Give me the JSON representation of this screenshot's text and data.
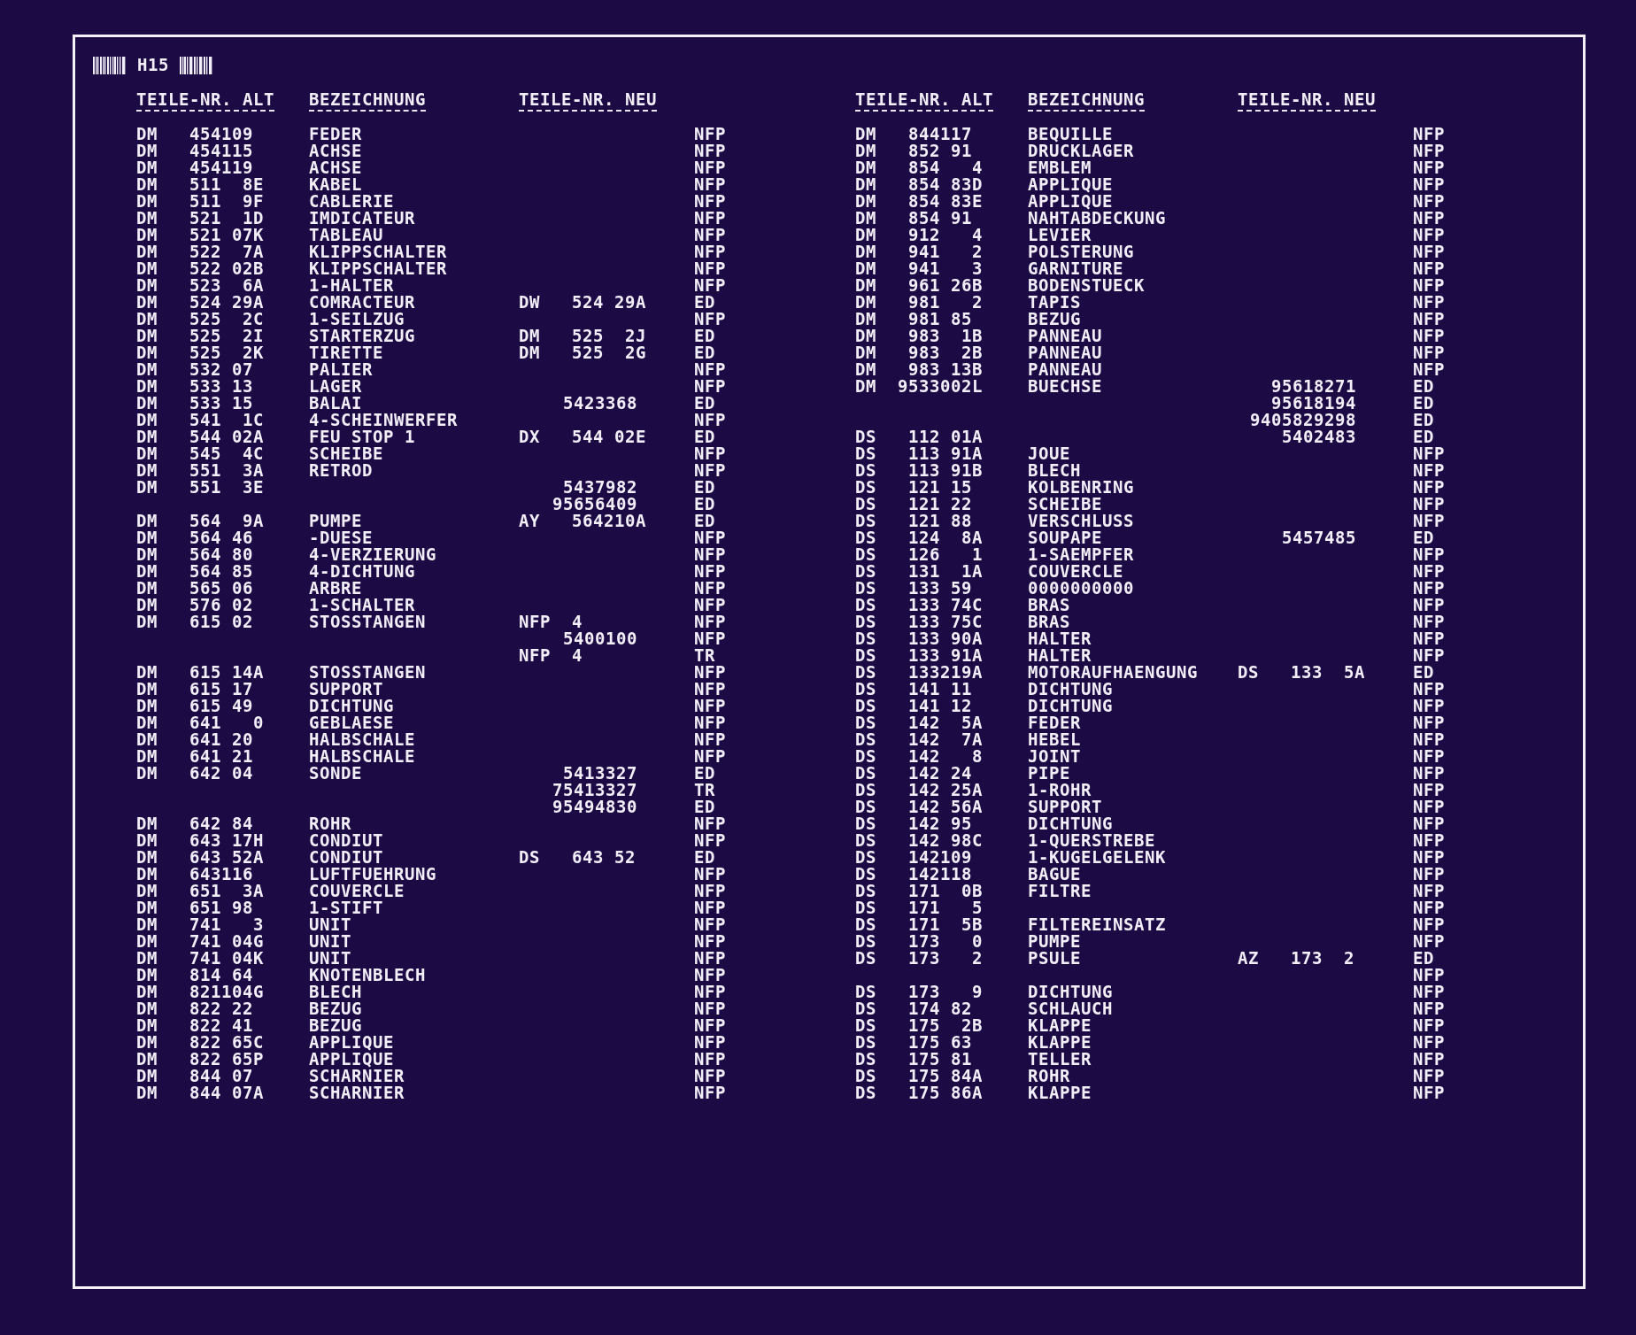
{
  "header": {
    "label": "H15"
  },
  "tables": [
    {
      "columns": [
        "TEILE-NR. ALT",
        "BEZEICHNUNG",
        "TEILE-NR. NEU"
      ],
      "rows": [
        {
          "old": "DM   454109",
          "desc": "FEDER",
          "code": "NFP"
        },
        {
          "old": "DM   454115",
          "desc": "ACHSE",
          "code": "NFP"
        },
        {
          "old": "DM   454119",
          "desc": "ACHSE",
          "code": "NFP"
        },
        {
          "old": "DM   511  8E",
          "desc": "KABEL",
          "code": "NFP"
        },
        {
          "old": "DM   511  9F",
          "desc": "CABLERIE",
          "code": "NFP"
        },
        {
          "old": "DM   521  1D",
          "desc": "IMDICATEUR",
          "code": "NFP"
        },
        {
          "old": "DM   521 07K",
          "desc": "TABLEAU",
          "code": "NFP"
        },
        {
          "old": "DM   522  7A",
          "desc": "KLIPPSCHALTER",
          "code": "NFP"
        },
        {
          "old": "DM   522 02B",
          "desc": "KLIPPSCHALTER",
          "code": "NFP"
        },
        {
          "old": "DM   523  6A",
          "desc": "1-HALTER",
          "code": "NFP"
        },
        {
          "old": "DM   524 29A",
          "desc": "COMRACTEUR",
          "new_ref": "DW   524 29A",
          "code": "ED"
        },
        {
          "old": "DM   525  2C",
          "desc": "1-SEILZUG",
          "code": "NFP"
        },
        {
          "old": "DM   525  2I",
          "desc": "STARTERZUG",
          "new_ref": "DM   525  2J",
          "code": "ED"
        },
        {
          "old": "DM   525  2K",
          "desc": "TIRETTE",
          "new_ref": "DM   525  2G",
          "code": "ED"
        },
        {
          "old": "DM   532 07",
          "desc": "PALIER",
          "code": "NFP"
        },
        {
          "old": "DM   533 13",
          "desc": "LAGER",
          "code": "NFP"
        },
        {
          "old": "DM   533 15",
          "desc": "BALAI",
          "new_no": "5423368",
          "code": "ED"
        },
        {
          "old": "DM   541  1C",
          "desc": "4-SCHEINWERFER",
          "code": "NFP"
        },
        {
          "old": "DM   544 02A",
          "desc": "FEU STOP 1",
          "new_ref": "DX   544 02E",
          "code": "ED"
        },
        {
          "old": "DM   545  4C",
          "desc": "SCHEIBE",
          "code": "NFP"
        },
        {
          "old": "DM   551  3A",
          "desc": "RETROD",
          "code": "NFP"
        },
        {
          "old": "DM   551  3E",
          "new_no": "5437982",
          "code": "ED"
        },
        {
          "new_no": "95656409",
          "code": "ED"
        },
        {
          "old": "DM   564  9A",
          "desc": "PUMPE",
          "new_ref": "AY   564210A",
          "code": "ED"
        },
        {
          "old": "DM   564 46",
          "desc": "-DUESE",
          "code": "NFP"
        },
        {
          "old": "DM   564 80",
          "desc": "4-VERZIERUNG",
          "code": "NFP"
        },
        {
          "old": "DM   564 85",
          "desc": "4-DICHTUNG",
          "code": "NFP"
        },
        {
          "old": "DM   565 06",
          "desc": "ARBRE",
          "code": "NFP"
        },
        {
          "old": "DM   576 02",
          "desc": "1-SCHALTER",
          "code": "NFP"
        },
        {
          "old": "DM   615 02",
          "desc": "STOSSTANGEN",
          "new_ref": "NFP  4",
          "code": "NFP"
        },
        {
          "new_no": "5400100",
          "code": "NFP"
        },
        {
          "new_ref": "NFP  4",
          "code": "TR"
        },
        {
          "old": "DM   615 14A",
          "desc": "STOSSTANGEN",
          "code": "NFP"
        },
        {
          "old": "DM   615 17",
          "desc": "SUPPORT",
          "code": "NFP"
        },
        {
          "old": "DM   615 49",
          "desc": "DICHTUNG",
          "code": "NFP"
        },
        {
          "old": "DM   641   0",
          "desc": "GEBLAESE",
          "code": "NFP"
        },
        {
          "old": "DM   641 20",
          "desc": "HALBSCHALE",
          "code": "NFP"
        },
        {
          "old": "DM   641 21",
          "desc": "HALBSCHALE",
          "code": "NFP"
        },
        {
          "old": "DM   642 04",
          "desc": "SONDE",
          "new_no": "5413327",
          "code": "ED"
        },
        {
          "new_no": "75413327",
          "code": "TR"
        },
        {
          "new_no": "95494830",
          "code": "ED"
        },
        {
          "old": "DM   642 84",
          "desc": "ROHR",
          "code": "NFP"
        },
        {
          "old": "DM   643 17H",
          "desc": "CONDIUT",
          "code": "NFP"
        },
        {
          "old": "DM   643 52A",
          "desc": "CONDIUT",
          "new_ref": "DS   643 52",
          "code": "ED"
        },
        {
          "old": "DM   643116",
          "desc": "LUFTFUEHRUNG",
          "code": "NFP"
        },
        {
          "old": "DM   651  3A",
          "desc": "COUVERCLE",
          "code": "NFP"
        },
        {
          "old": "DM   651 98",
          "desc": "1-STIFT",
          "code": "NFP"
        },
        {
          "old": "DM   741   3",
          "desc": "UNIT",
          "code": "NFP"
        },
        {
          "old": "DM   741 04G",
          "desc": "UNIT",
          "code": "NFP"
        },
        {
          "old": "DM   741 04K",
          "desc": "UNIT",
          "code": "NFP"
        },
        {
          "old": "DM   814 64",
          "desc": "KNOTENBLECH",
          "code": "NFP"
        },
        {
          "old": "DM   821104G",
          "desc": "BLECH",
          "code": "NFP"
        },
        {
          "old": "DM   822 22",
          "desc": "BEZUG",
          "code": "NFP"
        },
        {
          "old": "DM   822 41",
          "desc": "BEZUG",
          "code": "NFP"
        },
        {
          "old": "DM   822 65C",
          "desc": "APPLIQUE",
          "code": "NFP"
        },
        {
          "old": "DM   822 65P",
          "desc": "APPLIQUE",
          "code": "NFP"
        },
        {
          "old": "DM   844 07",
          "desc": "SCHARNIER",
          "code": "NFP"
        },
        {
          "old": "DM   844 07A",
          "desc": "SCHARNIER",
          "code": "NFP"
        }
      ]
    },
    {
      "columns": [
        "TEILE-NR. ALT",
        "BEZEICHNUNG",
        "TEILE-NR. NEU"
      ],
      "rows": [
        {
          "old": "DM   844117",
          "desc": "BEQUILLE",
          "code": "NFP"
        },
        {
          "old": "DM   852 91",
          "desc": "DRUCKLAGER",
          "code": "NFP"
        },
        {
          "old": "DM   854   4",
          "desc": "EMBLEM",
          "code": "NFP"
        },
        {
          "old": "DM   854 83D",
          "desc": "APPLIQUE",
          "code": "NFP"
        },
        {
          "old": "DM   854 83E",
          "desc": "APPLIQUE",
          "code": "NFP"
        },
        {
          "old": "DM   854 91",
          "desc": "NAHTABDECKUNG",
          "code": "NFP"
        },
        {
          "old": "DM   912   4",
          "desc": "LEVIER",
          "code": "NFP"
        },
        {
          "old": "DM   941   2",
          "desc": "POLSTERUNG",
          "code": "NFP"
        },
        {
          "old": "DM   941   3",
          "desc": "GARNITURE",
          "code": "NFP"
        },
        {
          "old": "DM   961 26B",
          "desc": "BODENSTUECK",
          "code": "NFP"
        },
        {
          "old": "DM   981   2",
          "desc": "TAPIS",
          "code": "NFP"
        },
        {
          "old": "DM   981 85",
          "desc": "BEZUG",
          "code": "NFP"
        },
        {
          "old": "DM   983  1B",
          "desc": "PANNEAU",
          "code": "NFP"
        },
        {
          "old": "DM   983  2B",
          "desc": "PANNEAU",
          "code": "NFP"
        },
        {
          "old": "DM   983 13B",
          "desc": "PANNEAU",
          "code": "NFP"
        },
        {
          "old": "DM  9533002L",
          "desc": "BUECHSE",
          "new_no": "95618271",
          "code": "ED"
        },
        {
          "new_no": "95618194",
          "code": "ED"
        },
        {
          "new_no": "9405829298",
          "code": "ED"
        },
        {
          "old": "DS   112 01A",
          "new_no": "5402483",
          "code": "ED"
        },
        {
          "old": "DS   113 91A",
          "desc": "JOUE",
          "code": "NFP"
        },
        {
          "old": "DS   113 91B",
          "desc": "BLECH",
          "code": "NFP"
        },
        {
          "old": "DS   121 15",
          "desc": "KOLBENRING",
          "code": "NFP"
        },
        {
          "old": "DS   121 22",
          "desc": "SCHEIBE",
          "code": "NFP"
        },
        {
          "old": "DS   121 88",
          "desc": "VERSCHLUSS",
          "code": "NFP"
        },
        {
          "old": "DS   124  8A",
          "desc": "SOUPAPE",
          "new_no": "5457485",
          "code": "ED"
        },
        {
          "old": "DS   126   1",
          "desc": "1-SAEMPFER",
          "code": "NFP"
        },
        {
          "old": "DS   131  1A",
          "desc": "COUVERCLE",
          "code": "NFP"
        },
        {
          "old": "DS   133 59",
          "desc": "0000000000",
          "code": "NFP"
        },
        {
          "old": "DS   133 74C",
          "desc": "BRAS",
          "code": "NFP"
        },
        {
          "old": "DS   133 75C",
          "desc": "BRAS",
          "code": "NFP"
        },
        {
          "old": "DS   133 90A",
          "desc": "HALTER",
          "code": "NFP"
        },
        {
          "old": "DS   133 91A",
          "desc": "HALTER",
          "code": "NFP"
        },
        {
          "old": "DS   133219A",
          "desc": "MOTORAUFHAENGUNG",
          "new_ref": "DS   133  5A",
          "code": "ED"
        },
        {
          "old": "DS   141 11",
          "desc": "DICHTUNG",
          "code": "NFP"
        },
        {
          "old": "DS   141 12",
          "desc": "DICHTUNG",
          "code": "NFP"
        },
        {
          "old": "DS   142  5A",
          "desc": "FEDER",
          "code": "NFP"
        },
        {
          "old": "DS   142  7A",
          "desc": "HEBEL",
          "code": "NFP"
        },
        {
          "old": "DS   142   8",
          "desc": "JOINT",
          "code": "NFP"
        },
        {
          "old": "DS   142 24",
          "desc": "PIPE",
          "code": "NFP"
        },
        {
          "old": "DS   142 25A",
          "desc": "1-ROHR",
          "code": "NFP"
        },
        {
          "old": "DS   142 56A",
          "desc": "SUPPORT",
          "code": "NFP"
        },
        {
          "old": "DS   142 95",
          "desc": "DICHTUNG",
          "code": "NFP"
        },
        {
          "old": "DS   142 98C",
          "desc": "1-QUERSTREBE",
          "code": "NFP"
        },
        {
          "old": "DS   142109",
          "desc": "1-KUGELGELENK",
          "code": "NFP"
        },
        {
          "old": "DS   142118",
          "desc": "BAGUE",
          "code": "NFP"
        },
        {
          "old": "DS   171  0B",
          "desc": "FILTRE",
          "code": "NFP"
        },
        {
          "old": "DS   171   5",
          "code": "NFP"
        },
        {
          "old": "DS   171  5B",
          "desc": "FILTEREINSATZ",
          "code": "NFP"
        },
        {
          "old": "DS   173   0",
          "desc": "PUMPE",
          "code": "NFP"
        },
        {
          "old": "DS   173   2",
          "desc": "PSULE",
          "new_ref": "AZ   173  2",
          "code": "ED"
        },
        {
          "code": "NFP"
        },
        {
          "old": "DS   173   9",
          "desc": "DICHTUNG",
          "code": "NFP"
        },
        {
          "old": "DS   174 82",
          "desc": "SCHLAUCH",
          "code": "NFP"
        },
        {
          "old": "DS   175  2B",
          "desc": "KLAPPE",
          "code": "NFP"
        },
        {
          "old": "DS   175 63",
          "desc": "KLAPPE",
          "code": "NFP"
        },
        {
          "old": "DS   175 81",
          "desc": "TELLER",
          "code": "NFP"
        },
        {
          "old": "DS   175 84A",
          "desc": "ROHR",
          "code": "NFP"
        },
        {
          "old": "DS   175 86A",
          "desc": "KLAPPE",
          "code": "NFP"
        }
      ]
    }
  ]
}
